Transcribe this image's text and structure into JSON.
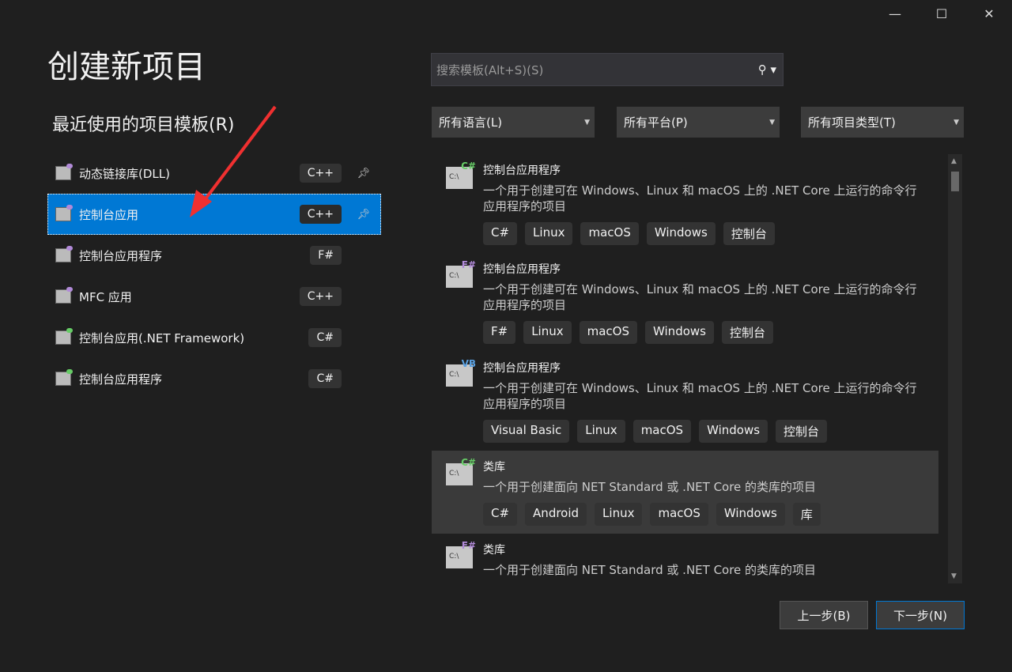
{
  "window": {
    "minimize": "—",
    "maximize": "☐",
    "close": "✕"
  },
  "title": "创建新项目",
  "recent_heading": "最近使用的项目模板(R)",
  "recent": [
    {
      "label": "动态链接库(DLL)",
      "lang": "C++",
      "pinned": true
    },
    {
      "label": "控制台应用",
      "lang": "C++",
      "pinned": true,
      "selected": true
    },
    {
      "label": "控制台应用程序",
      "lang": "F#"
    },
    {
      "label": "MFC 应用",
      "lang": "C++"
    },
    {
      "label": "控制台应用(.NET Framework)",
      "lang": "C#"
    },
    {
      "label": "控制台应用程序",
      "lang": "C#"
    }
  ],
  "search": {
    "placeholder": "搜索模板(Alt+S)(S)"
  },
  "filters": {
    "language": "所有语言(L)",
    "platform": "所有平台(P)",
    "type": "所有项目类型(T)"
  },
  "templates": [
    {
      "badge": "C#",
      "name": "控制台应用程序",
      "desc": "一个用于创建可在 Windows、Linux 和 macOS 上的 .NET Core 上运行的命令行应用程序的项目",
      "tags": [
        "C#",
        "Linux",
        "macOS",
        "Windows",
        "控制台"
      ],
      "badge_color": "#6c6"
    },
    {
      "badge": "F#",
      "name": "控制台应用程序",
      "desc": "一个用于创建可在 Windows、Linux 和 macOS 上的 .NET Core 上运行的命令行应用程序的项目",
      "tags": [
        "F#",
        "Linux",
        "macOS",
        "Windows",
        "控制台"
      ],
      "badge_color": "#b18ad8"
    },
    {
      "badge": "VB",
      "name": "控制台应用程序",
      "desc": "一个用于创建可在 Windows、Linux 和 macOS 上的 .NET Core 上运行的命令行应用程序的项目",
      "tags": [
        "Visual Basic",
        "Linux",
        "macOS",
        "Windows",
        "控制台"
      ],
      "badge_color": "#5aa0e0"
    },
    {
      "badge": "C#",
      "name": "类库",
      "desc": "一个用于创建面向 NET Standard 或 .NET Core 的类库的项目",
      "tags": [
        "C#",
        "Android",
        "Linux",
        "macOS",
        "Windows",
        "库"
      ],
      "badge_color": "#6c6",
      "hover": true
    },
    {
      "badge": "F#",
      "name": "类库",
      "desc": "一个用于创建面向 NET Standard 或 .NET Core 的类库的项目",
      "tags": [],
      "badge_color": "#b18ad8"
    }
  ],
  "buttons": {
    "back": "上一步(B)",
    "next": "下一步(N)"
  },
  "accent": "#0078d4"
}
